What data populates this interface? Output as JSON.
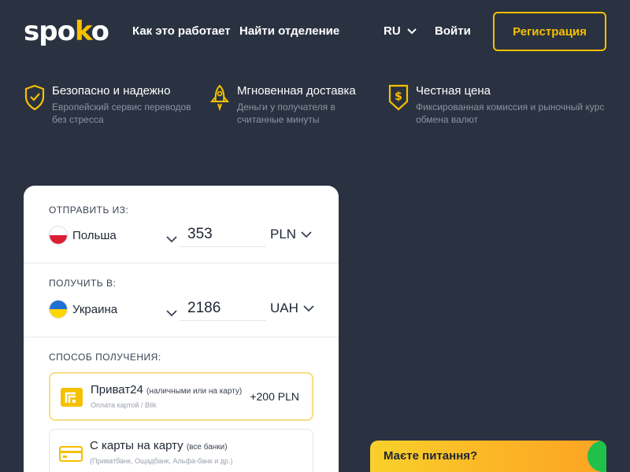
{
  "header": {
    "logo_main": "spo",
    "logo_accent": "k",
    "logo_end": "o",
    "nav": {
      "how_it_works": "Как это работает",
      "find_branch": "Найти отделение"
    },
    "language": "RU",
    "login": "Войти",
    "register": "Регистрация"
  },
  "features": [
    {
      "title": "Безопасно и надежно",
      "desc_line1": "Европейский сервис переводов",
      "desc_line2": "без стресса",
      "icon": "shield-check-icon"
    },
    {
      "title": "Мгновенная доставка",
      "desc_line1": "Деньги у получателя в",
      "desc_line2": "считанные минуты",
      "icon": "rocket-icon"
    },
    {
      "title": "Честная цена",
      "desc_line1": "Фиксированная комиссия и рыночный курс",
      "desc_line2": "обмена валют",
      "icon": "dollar-tag-icon"
    }
  ],
  "transfer": {
    "send": {
      "label": "ОТПРАВИТЬ ИЗ:",
      "country": "Польша",
      "amount": "353",
      "currency": "PLN"
    },
    "receive": {
      "label": "ПОЛУЧИТЬ В:",
      "country": "Украина",
      "amount": "2186",
      "currency": "UAH"
    },
    "method": {
      "label": "СПОСОБ ПОЛУЧЕНИЯ:",
      "options": [
        {
          "title": "Приват24",
          "note": "(наличными или на карту)",
          "sub": "Оплата картой / Blik",
          "fee": "+200 PLN",
          "icon": "privat24-icon"
        },
        {
          "title": "С карты на карту",
          "note": "(все банки)",
          "sub": "(Приватбанк, Ощадбанк, Альфа-банк и др.)",
          "fee": "",
          "icon": "credit-card-icon"
        }
      ]
    }
  },
  "chat": {
    "label": "Маєте питання?"
  },
  "colors": {
    "background": "#2a3241",
    "accent": "#f5c000",
    "card": "#ffffff",
    "muted_text": "#8c94a3",
    "chat_green": "#1fc14a"
  }
}
